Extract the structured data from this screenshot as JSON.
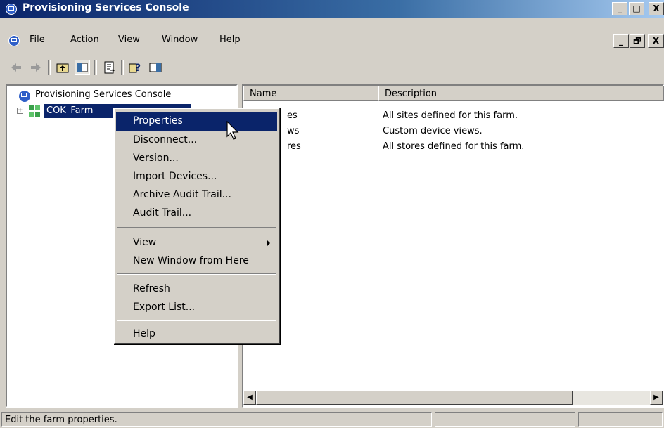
{
  "window": {
    "title": "Provisioning Services Console",
    "caption_buttons": [
      "_",
      "□",
      "X"
    ],
    "mdi_buttons": [
      "_",
      "🗗",
      "X"
    ]
  },
  "menubar": {
    "items": [
      {
        "label": "File"
      },
      {
        "label": "Action"
      },
      {
        "label": "View"
      },
      {
        "label": "Window"
      },
      {
        "label": "Help"
      }
    ]
  },
  "toolbar": {
    "icons": [
      "back-arrow-icon",
      "forward-arrow-icon",
      "up-folder-icon",
      "show-hide-tree-icon",
      "export-list-icon",
      "help-icon",
      "show-hide-action-pane-icon"
    ]
  },
  "tree": {
    "root_label": "Provisioning Services Console",
    "farm_label": "COK_Farm"
  },
  "list": {
    "columns": [
      "Name",
      "Description"
    ],
    "rows": [
      {
        "name": "es",
        "description": "All sites defined for this farm."
      },
      {
        "name": "ws",
        "description": "Custom device views."
      },
      {
        "name": "res",
        "description": "All stores defined for this farm."
      }
    ]
  },
  "context_menu": {
    "items": [
      {
        "label": "Properties",
        "selected": true
      },
      {
        "label": "Disconnect..."
      },
      {
        "label": "Version..."
      },
      {
        "label": "Import Devices..."
      },
      {
        "label": "Archive Audit Trail..."
      },
      {
        "label": "Audit Trail..."
      },
      {
        "label": "View",
        "submenu": true
      },
      {
        "label": "New Window from Here"
      },
      {
        "label": "Refresh"
      },
      {
        "label": "Export List..."
      },
      {
        "label": "Help"
      }
    ]
  },
  "statusbar": {
    "text": "Edit the farm properties."
  },
  "colors": {
    "titlebar": "#0a246a",
    "selection": "#0a246a",
    "face": "#d4d0c8"
  }
}
